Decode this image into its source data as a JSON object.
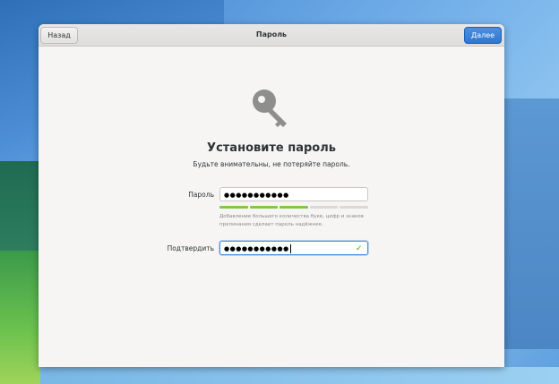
{
  "window": {
    "title": "Пароль",
    "back_label": "Назад",
    "next_label": "Далее"
  },
  "content": {
    "icon": "key-icon",
    "heading": "Установите пароль",
    "subheading": "Будьте внимательны, не потеряйте пароль.",
    "password_label": "Пароль",
    "password_value": "●●●●●●●●●●●",
    "strength_hint": "Добавление большего количества букв, цифр и знаков препинания сделает пароль надёжнее.",
    "strength_level": 0.6,
    "confirm_label": "Подтвердить",
    "confirm_value": "●●●●●●●●●●●",
    "confirm_status_icon": "checkmark-icon"
  },
  "colors": {
    "accent": "#3584e4",
    "strength_fill": "#7ec84a",
    "check": "#4e9a06"
  }
}
